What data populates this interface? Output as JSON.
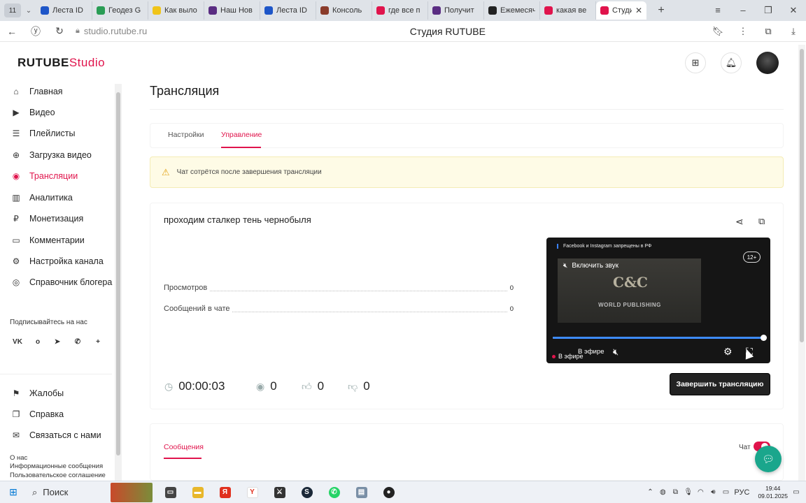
{
  "browser": {
    "tab_count": "11",
    "tabs": [
      {
        "label": "Леста ID",
        "color": "#1e56c8"
      },
      {
        "label": "Геодез G",
        "color": "#2a9d55"
      },
      {
        "label": "Как выло",
        "color": "#f0c419"
      },
      {
        "label": "Наш Нов",
        "color": "#5a2d82"
      },
      {
        "label": "Леста ID",
        "color": "#1e56c8"
      },
      {
        "label": "Консоль",
        "color": "#8a3b2a"
      },
      {
        "label": "где все п",
        "color": "#e0144c"
      },
      {
        "label": "Получит",
        "color": "#5a2d82"
      },
      {
        "label": "Ежемесяч",
        "color": "#222222"
      },
      {
        "label": "какая ве",
        "color": "#e0144c"
      },
      {
        "label": "Студи",
        "color": "#e0144c",
        "active": true
      }
    ],
    "url": "studio.rutube.ru",
    "page_title": "Студия RUTUBE"
  },
  "app": {
    "logo_main": "RUTUBE",
    "logo_studio": "Studio"
  },
  "sidebar": {
    "items": [
      {
        "label": "Главная",
        "icon": "home-icon",
        "glyph": "⌂"
      },
      {
        "label": "Видео",
        "icon": "video-icon",
        "glyph": "▶"
      },
      {
        "label": "Плейлисты",
        "icon": "playlist-icon",
        "glyph": "☰"
      },
      {
        "label": "Загрузка видео",
        "icon": "upload-icon",
        "glyph": "⊕"
      },
      {
        "label": "Трансляции",
        "icon": "broadcast-icon",
        "glyph": "◉",
        "active": true
      },
      {
        "label": "Аналитика",
        "icon": "analytics-icon",
        "glyph": "▥"
      },
      {
        "label": "Монетизация",
        "icon": "money-icon",
        "glyph": "₽"
      },
      {
        "label": "Комментарии",
        "icon": "comments-icon",
        "glyph": "▭"
      },
      {
        "label": "Настройка канала",
        "icon": "settings-icon",
        "glyph": "⚙"
      },
      {
        "label": "Справочник блогера",
        "icon": "handbook-icon",
        "glyph": "◎"
      }
    ],
    "subscribe_title": "Подписывайтесь на нас",
    "socials": [
      {
        "name": "vk-icon",
        "glyph": "VK"
      },
      {
        "name": "ok-icon",
        "glyph": "ᴏ"
      },
      {
        "name": "telegram-icon",
        "glyph": "➤"
      },
      {
        "name": "viber-icon",
        "glyph": "✆"
      },
      {
        "name": "more-socials-icon",
        "glyph": "+"
      }
    ],
    "bottom_items": [
      {
        "label": "Жалобы",
        "icon": "flag-icon",
        "glyph": "⚑"
      },
      {
        "label": "Справка",
        "icon": "help-icon",
        "glyph": "❐"
      },
      {
        "label": "Связаться с нами",
        "icon": "mail-icon",
        "glyph": "✉"
      }
    ],
    "footer_links": [
      "О нас",
      "Информационные сообщения",
      "Пользовательское соглашение"
    ]
  },
  "main": {
    "title": "Трансляция",
    "tabs": [
      {
        "label": "Настройки",
        "active": false
      },
      {
        "label": "Управление",
        "active": true
      }
    ],
    "warning": "Чат сотрётся после завершения трансляции",
    "stream": {
      "name": "проходим сталкер тень чернобыля",
      "stats": [
        {
          "label": "Просмотров",
          "value": "0"
        },
        {
          "label": "Сообщений в чате",
          "value": "0"
        }
      ],
      "duration": "00:00:03",
      "viewers": "0",
      "likes": "0",
      "dislikes": "0",
      "end_button": "Завершить трансляцию"
    },
    "player": {
      "banner": "Facebook и Instagram запрещены в РФ",
      "age": "12+",
      "unmute": "Включить звук",
      "video_logo": "C&C",
      "video_logo_sub": "WORLD PUBLISHING",
      "live_label": "В эфире",
      "live_label_2": "В эфире",
      "progress": 1.0
    },
    "chat": {
      "tab": "Сообщения",
      "toggle_label": "Чат"
    }
  },
  "taskbar": {
    "search": "Поиск",
    "lang": "РУС",
    "time": "19:44",
    "date": "09.01.2025"
  }
}
